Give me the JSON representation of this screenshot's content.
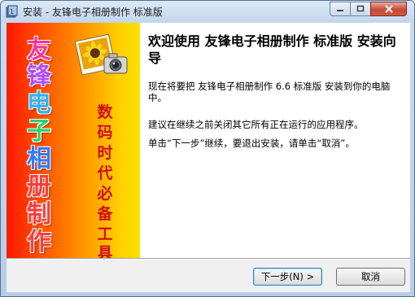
{
  "window": {
    "title": "安装 - 友锋电子相册制作 标准版",
    "icons": {
      "app": "installer-app-icon",
      "minimize": "minimize-icon",
      "maximize": "maximize-icon",
      "close": "close-icon"
    }
  },
  "banner": {
    "product_chars": [
      "友",
      "锋",
      "电",
      "子",
      "相",
      "册",
      "制",
      "作"
    ],
    "product_colors": [
      "#ff2fa0",
      "#b34bff",
      "#2bb4ff",
      "#26d36a",
      "#2e7bff",
      "#ff3b3b",
      "#ff3b3b",
      "#ff3b3b"
    ],
    "slogan_chars": [
      "数",
      "码",
      "时",
      "代",
      "必",
      "备",
      "工",
      "具"
    ],
    "slogan_color": "#d01010",
    "image_icon": "sunflower-camera-icon"
  },
  "content": {
    "headline": "欢迎使用 友锋电子相册制作 标准版 安装向导",
    "paragraph1": "现在将要把 友锋电子相册制作 6.6 标准版 安装到你的电脑中。",
    "paragraph2": "建议在继续之前关闭其它所有正在运行的应用程序。",
    "paragraph3": "单击“下一步”继续，要退出安装，请单击“取消”。"
  },
  "buttons": {
    "next": "下一步(N) >",
    "cancel": "取消"
  }
}
